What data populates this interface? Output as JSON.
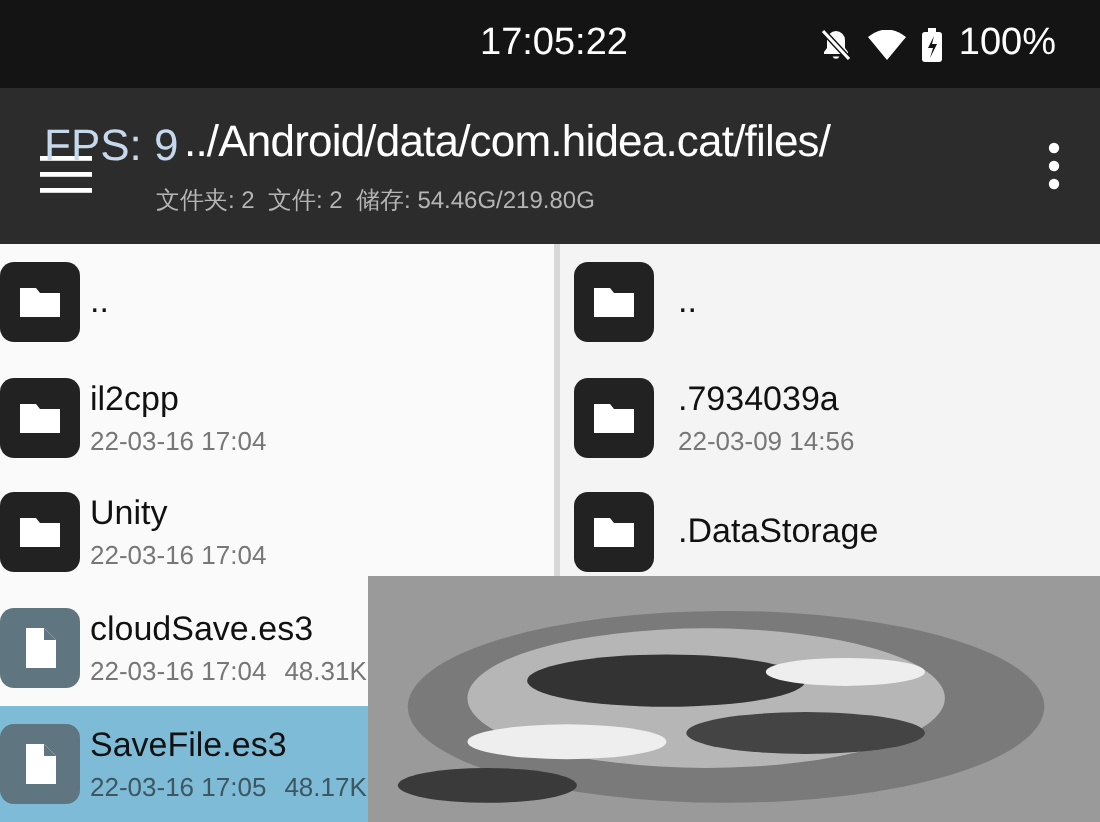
{
  "status_bar": {
    "time": "17:05:22",
    "battery": "100%"
  },
  "fps_overlay": "FPS: 9",
  "toolbar": {
    "path": "../Android/data/com.hidea.cat/files/",
    "stats": "文件夹: 2  文件: 2  储存: 54.46G/219.80G"
  },
  "panes": [
    {
      "rows": [
        {
          "kind": "folder",
          "name": "..",
          "selected": false
        },
        {
          "kind": "folder",
          "name": "il2cpp",
          "date": "22-03-16 17:04",
          "selected": false
        },
        {
          "kind": "folder",
          "name": "Unity",
          "date": "22-03-16 17:04",
          "selected": false
        },
        {
          "kind": "file",
          "name": "cloudSave.es3",
          "date": "22-03-16 17:04",
          "size": "48.31K",
          "selected": false
        },
        {
          "kind": "file",
          "name": "SaveFile.es3",
          "date": "22-03-16 17:05",
          "size": "48.17K",
          "selected": true
        }
      ]
    },
    {
      "rows": [
        {
          "kind": "folder",
          "name": "..",
          "selected": false
        },
        {
          "kind": "folder",
          "name": ".7934039a",
          "date": "22-03-09 14:56",
          "selected": false
        },
        {
          "kind": "folder",
          "name": ".DataStorage",
          "selected": false
        }
      ]
    }
  ]
}
